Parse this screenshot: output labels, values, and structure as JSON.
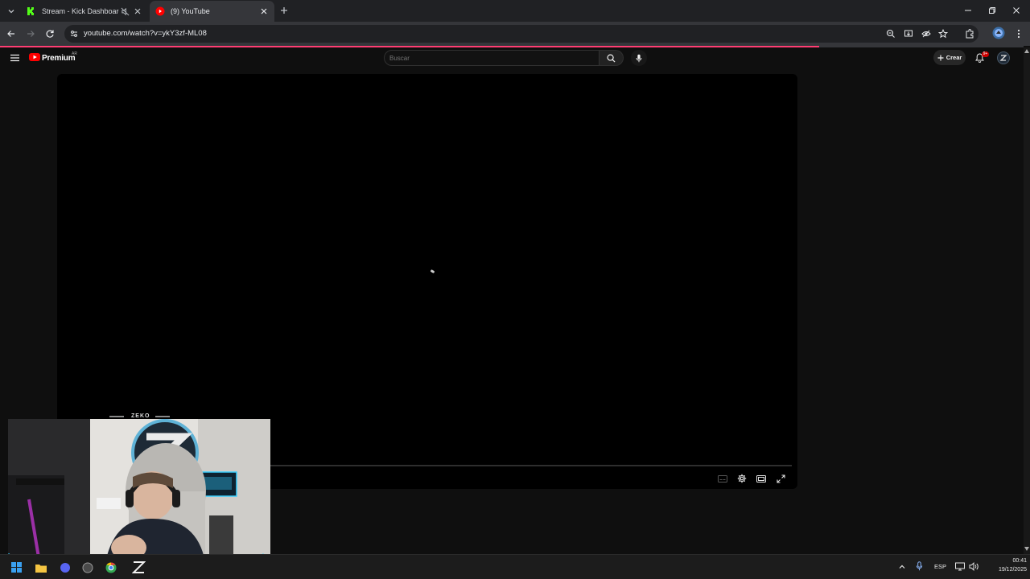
{
  "browser": {
    "tabs": [
      {
        "label": "Stream - Kick Dashboard",
        "favicon": "kick-icon",
        "muted": true
      },
      {
        "label": "(9) YouTube",
        "favicon": "youtube-icon",
        "active": true
      }
    ],
    "address": {
      "url": "youtube.com/watch?v=ykY3zf-ML08"
    },
    "load_progress": 0.8
  },
  "youtube": {
    "logo_text": "Premium",
    "region": "AR",
    "search": {
      "placeholder": "Buscar"
    },
    "create_label": "Crear",
    "notifications_badge": "9+",
    "avatar_letter": "Z"
  },
  "player": {
    "state": "loading",
    "controls": [
      "subtitles-icon",
      "settings-icon",
      "theater-icon",
      "fullscreen-icon"
    ]
  },
  "webcam": {
    "label": "ZEKO",
    "wall_logo_letter": "Z"
  },
  "taskbar": {
    "language": "ESP",
    "time": "00:41",
    "date": "19/12/2025",
    "colors": {
      "accent": "#ff3d73",
      "youtube_red": "#ff0000",
      "kick_green": "#53fc18"
    }
  }
}
